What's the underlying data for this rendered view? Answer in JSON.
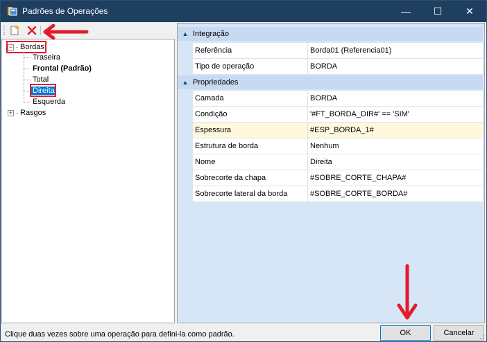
{
  "window": {
    "title": "Padrões de Operações",
    "minimize_glyph": "—",
    "maximize_glyph": "☐",
    "close_glyph": "✕"
  },
  "toolbar": {
    "new_icon": "new-document-icon",
    "delete_icon": "delete-x-icon"
  },
  "tree": {
    "root1": {
      "label": "Bordas",
      "expander": "−"
    },
    "children": [
      {
        "label": "Traseira"
      },
      {
        "label": "Frontal (Padrão)"
      },
      {
        "label": "Total"
      },
      {
        "label": "Direita"
      },
      {
        "label": "Esquerda"
      }
    ],
    "root2": {
      "label": "Rasgos",
      "expander": "+"
    }
  },
  "grid": {
    "categories": [
      {
        "label": "Integração",
        "rows": [
          {
            "name": "Referência",
            "value": "Borda01 (Referencia01)"
          },
          {
            "name": "Tipo de operação",
            "value": "BORDA"
          }
        ]
      },
      {
        "label": "Propriedades",
        "rows": [
          {
            "name": "Camada",
            "value": "BORDA"
          },
          {
            "name": "Condição",
            "value": "'#FT_BORDA_DIR#' == 'SIM'"
          },
          {
            "name": "Espessura",
            "value": "#ESP_BORDA_1#"
          },
          {
            "name": "Estrutura de borda",
            "value": "Nenhum"
          },
          {
            "name": "Nome",
            "value": "Direita"
          },
          {
            "name": "Sobrecorte da chapa",
            "value": "#SOBRE_CORTE_CHAPA#"
          },
          {
            "name": "Sobrecorte lateral da borda",
            "value": "#SOBRE_CORTE_BORDA#"
          }
        ]
      }
    ]
  },
  "status": {
    "text": "Clique duas vezes sobre uma operação para defini-la como padrão."
  },
  "buttons": {
    "ok": "OK",
    "cancel": "Cancelar"
  },
  "colors": {
    "titlebar": "#1f3f60",
    "selection": "#0078d7",
    "annotation_red": "#e21c2c",
    "grid_background": "#d7e6f7",
    "highlight_row": "#fff8dc"
  }
}
